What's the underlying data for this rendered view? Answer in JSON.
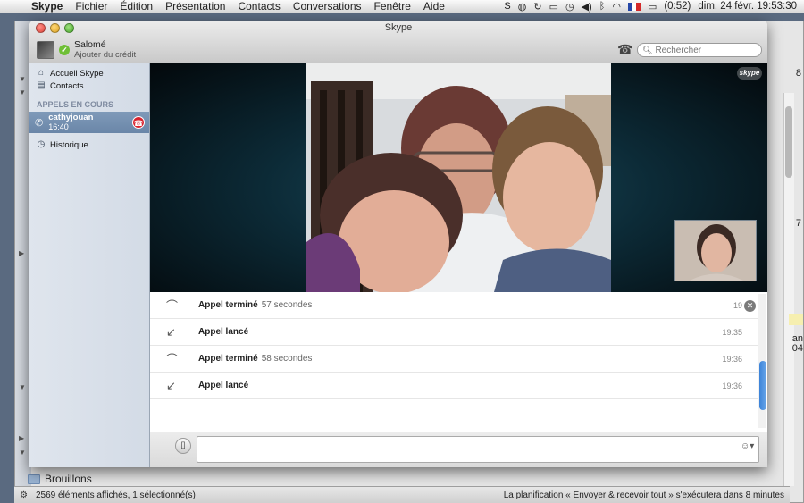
{
  "menubar": {
    "apple_icon": "apple-logo",
    "app_name": "Skype",
    "menus": [
      "Fichier",
      "Édition",
      "Présentation",
      "Contacts",
      "Conversations",
      "Fenêtre",
      "Aide"
    ],
    "battery": "(0:52)",
    "clock": "dim. 24 févr.  19:53:30"
  },
  "background_window": {
    "folder_label": "Brouillons",
    "right_snippet_1": "8",
    "right_snippet_2": "7",
    "right_snippet_3a": "an",
    "right_snippet_3b": "04"
  },
  "statusbar": {
    "left": "2569 éléments affichés, 1 sélectionné(s)",
    "right": "La planification « Envoyer & recevoir tout » s'exécutera dans 8 minutes"
  },
  "skype": {
    "window_title": "Skype",
    "user_name": "Salomé",
    "credit_link": "Ajouter du crédit",
    "search_placeholder": "Rechercher",
    "sidebar": {
      "items": [
        {
          "label": "Accueil Skype",
          "icon": "home-icon"
        },
        {
          "label": "Contacts",
          "icon": "contacts-icon"
        }
      ],
      "section_title": "APPELS EN COURS",
      "active_call": {
        "name": "cathyjouan",
        "time": "16:40"
      },
      "history_label": "Historique"
    },
    "video": {
      "logo_text": "skype"
    },
    "history": [
      {
        "action": "Appel terminé",
        "duration": "57 secondes",
        "time": "19",
        "icon": "call-ended-icon"
      },
      {
        "action": "Appel lancé",
        "duration": "",
        "time": "19:35",
        "icon": "call-started-icon"
      },
      {
        "action": "Appel terminé",
        "duration": "58 secondes",
        "time": "19:36",
        "icon": "call-ended-icon"
      },
      {
        "action": "Appel lancé",
        "duration": "",
        "time": "19:36",
        "icon": "call-started-icon"
      }
    ],
    "colors": {
      "hangup": "#d9232e",
      "presence": "#6fbf36",
      "selected_call": "#6a86a8",
      "scroll_thumb": "#3c83d8"
    }
  }
}
